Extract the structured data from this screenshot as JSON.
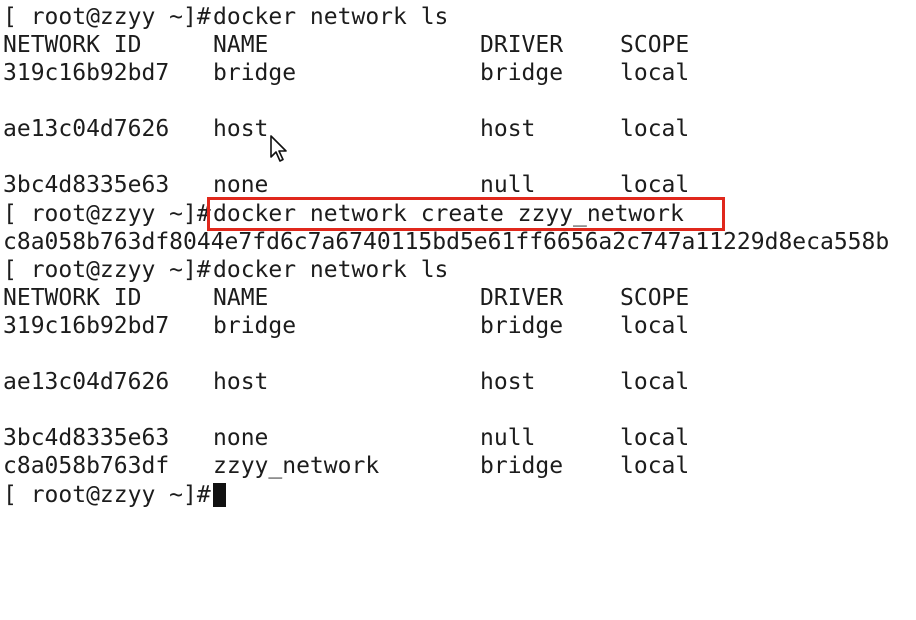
{
  "terminal": {
    "prompt": "[ root@zzyy ~]# ",
    "lines": {
      "cmd1": "docker network ls",
      "cmd2": "docker network create zzyy_network",
      "network_id_output": "c8a058b763df8044e7fd6c7a6740115bd5e61ff6656a2c747a11229d8eca558b",
      "cmd3": "docker network ls"
    },
    "headers": [
      "NETWORK ID",
      "NAME",
      "DRIVER",
      "SCOPE"
    ],
    "table1": [
      {
        "id": "319c16b92bd7",
        "name": "bridge",
        "driver": "bridge",
        "scope": "local"
      },
      {
        "id": "ae13c04d7626",
        "name": "host",
        "driver": "host",
        "scope": "local"
      },
      {
        "id": "3bc4d8335e63",
        "name": "none",
        "driver": "null",
        "scope": "local"
      }
    ],
    "table2": [
      {
        "id": "319c16b92bd7",
        "name": "bridge",
        "driver": "bridge",
        "scope": "local"
      },
      {
        "id": "ae13c04d7626",
        "name": "host",
        "driver": "host",
        "scope": "local"
      },
      {
        "id": "3bc4d8335e63",
        "name": "none",
        "driver": "null",
        "scope": "local"
      },
      {
        "id": "c8a058b763df",
        "name": "zzyy_network",
        "driver": "bridge",
        "scope": "local"
      }
    ]
  },
  "colors": {
    "background": "#ffffff",
    "text": "#1c1c1c",
    "highlight_border": "#e0281c"
  },
  "icons": {
    "cursor": "mouse-pointer-icon",
    "text_cursor": "block-cursor"
  }
}
